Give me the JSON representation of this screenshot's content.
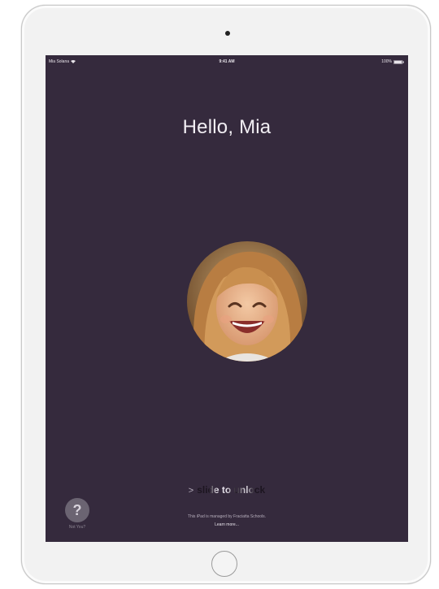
{
  "status_bar": {
    "carrier": "Mia Solana",
    "time": "9:41 AM",
    "battery": "100%"
  },
  "lock_screen": {
    "greeting": "Hello, Mia",
    "slide_chevron": ">",
    "slide_label": "slide to unlock",
    "help_symbol": "?",
    "help_label": "Not You?",
    "managed_note": "This iPad is managed by Fraciatta Schools.",
    "learn_more": "Learn more..."
  },
  "colors": {
    "screen_background": "#352a3d",
    "device_bezel": "#f2f2f2"
  }
}
